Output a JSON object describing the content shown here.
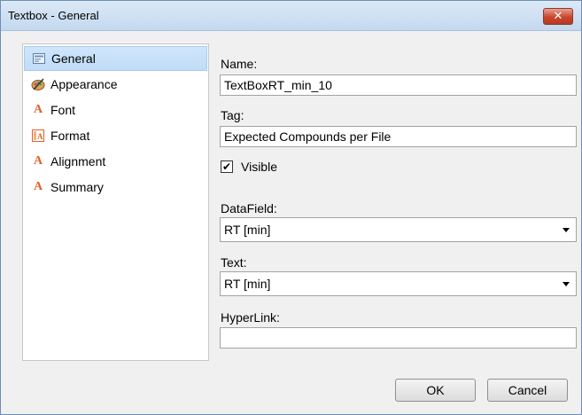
{
  "window": {
    "title": "Textbox - General",
    "close_glyph": "✕"
  },
  "nav": {
    "items": [
      {
        "label": "General",
        "icon": "general-icon",
        "selected": true
      },
      {
        "label": "Appearance",
        "icon": "appearance-icon",
        "selected": false
      },
      {
        "label": "Font",
        "icon": "font-icon",
        "selected": false
      },
      {
        "label": "Format",
        "icon": "format-icon",
        "selected": false
      },
      {
        "label": "Alignment",
        "icon": "alignment-icon",
        "selected": false
      },
      {
        "label": "Summary",
        "icon": "summary-icon",
        "selected": false
      }
    ]
  },
  "form": {
    "name_label": "Name:",
    "name_value": "TextBoxRT_min_10",
    "tag_label": "Tag:",
    "tag_value": "Expected Compounds per File",
    "visible_label": "Visible",
    "visible_checked": true,
    "datafield_label": "DataField:",
    "datafield_value": "RT [min]",
    "text_label": "Text:",
    "text_value": "RT [min]",
    "hyperlink_label": "HyperLink:",
    "hyperlink_value": ""
  },
  "buttons": {
    "ok": "OK",
    "cancel": "Cancel"
  },
  "colors": {
    "selection": "#c9e2fa",
    "font_icon": "#e0602a",
    "close_button": "#c8462b"
  }
}
